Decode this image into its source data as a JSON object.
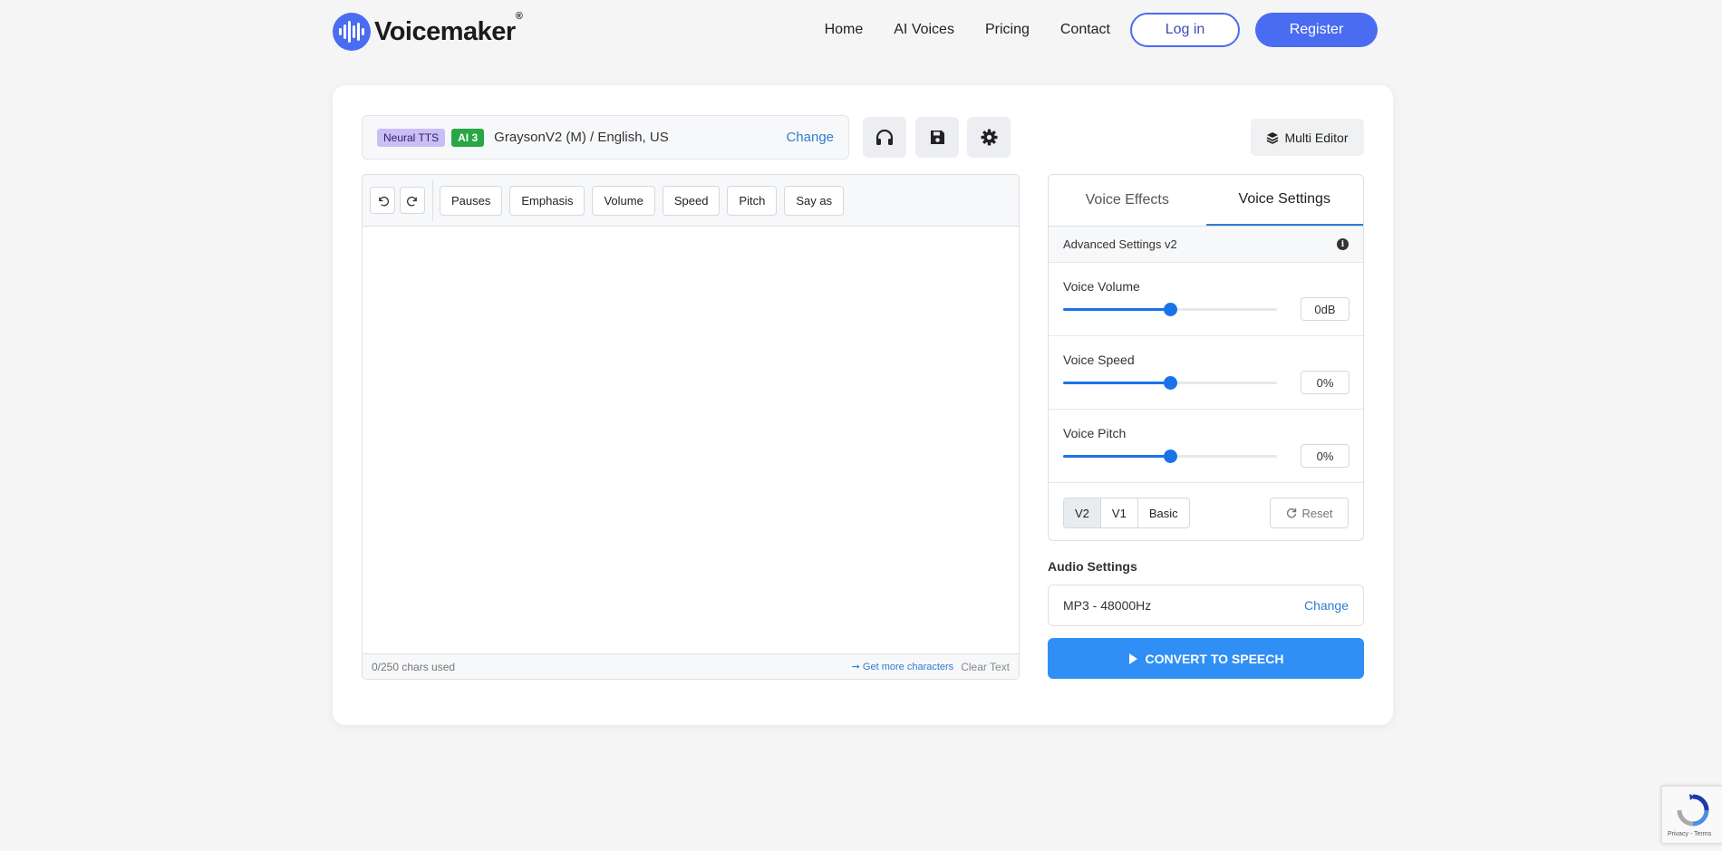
{
  "header": {
    "logo_text": "Voicemaker",
    "logo_reg": "®",
    "nav": [
      "Home",
      "AI Voices",
      "Pricing",
      "Contact"
    ],
    "login_label": "Log in",
    "register_label": "Register"
  },
  "voice": {
    "badge_tts": "Neural TTS",
    "badge_ai": "AI 3",
    "name": "GraysonV2 (M) / English, US",
    "change_label": "Change"
  },
  "multi_editor_label": "Multi Editor",
  "editor": {
    "tools": [
      "Pauses",
      "Emphasis",
      "Volume",
      "Speed",
      "Pitch",
      "Say as"
    ],
    "chars_used": "0/250 chars used",
    "get_more": "➞ Get more characters",
    "clear_text": "Clear Text"
  },
  "panel": {
    "tabs": [
      "Voice Effects",
      "Voice Settings"
    ],
    "active_tab": "Voice Settings",
    "advanced_label": "Advanced Settings v2",
    "sliders": [
      {
        "label": "Voice Volume",
        "value": "0dB",
        "position": 0.5
      },
      {
        "label": "Voice Speed",
        "value": "0%",
        "position": 0.5
      },
      {
        "label": "Voice Pitch",
        "value": "0%",
        "position": 0.5
      }
    ],
    "versions": [
      "V2",
      "V1",
      "Basic"
    ],
    "active_version": "V2",
    "reset_label": "Reset"
  },
  "audio": {
    "title": "Audio Settings",
    "format": "MP3 - 48000Hz",
    "change_label": "Change"
  },
  "convert_label": "CONVERT TO SPEECH",
  "recaptcha_terms": "Privacy - Terms",
  "colors": {
    "brand": "#4a6cf0",
    "accent_blue": "#2f8ff5",
    "link": "#2d7fd0",
    "badge_ai": "#28a745"
  }
}
